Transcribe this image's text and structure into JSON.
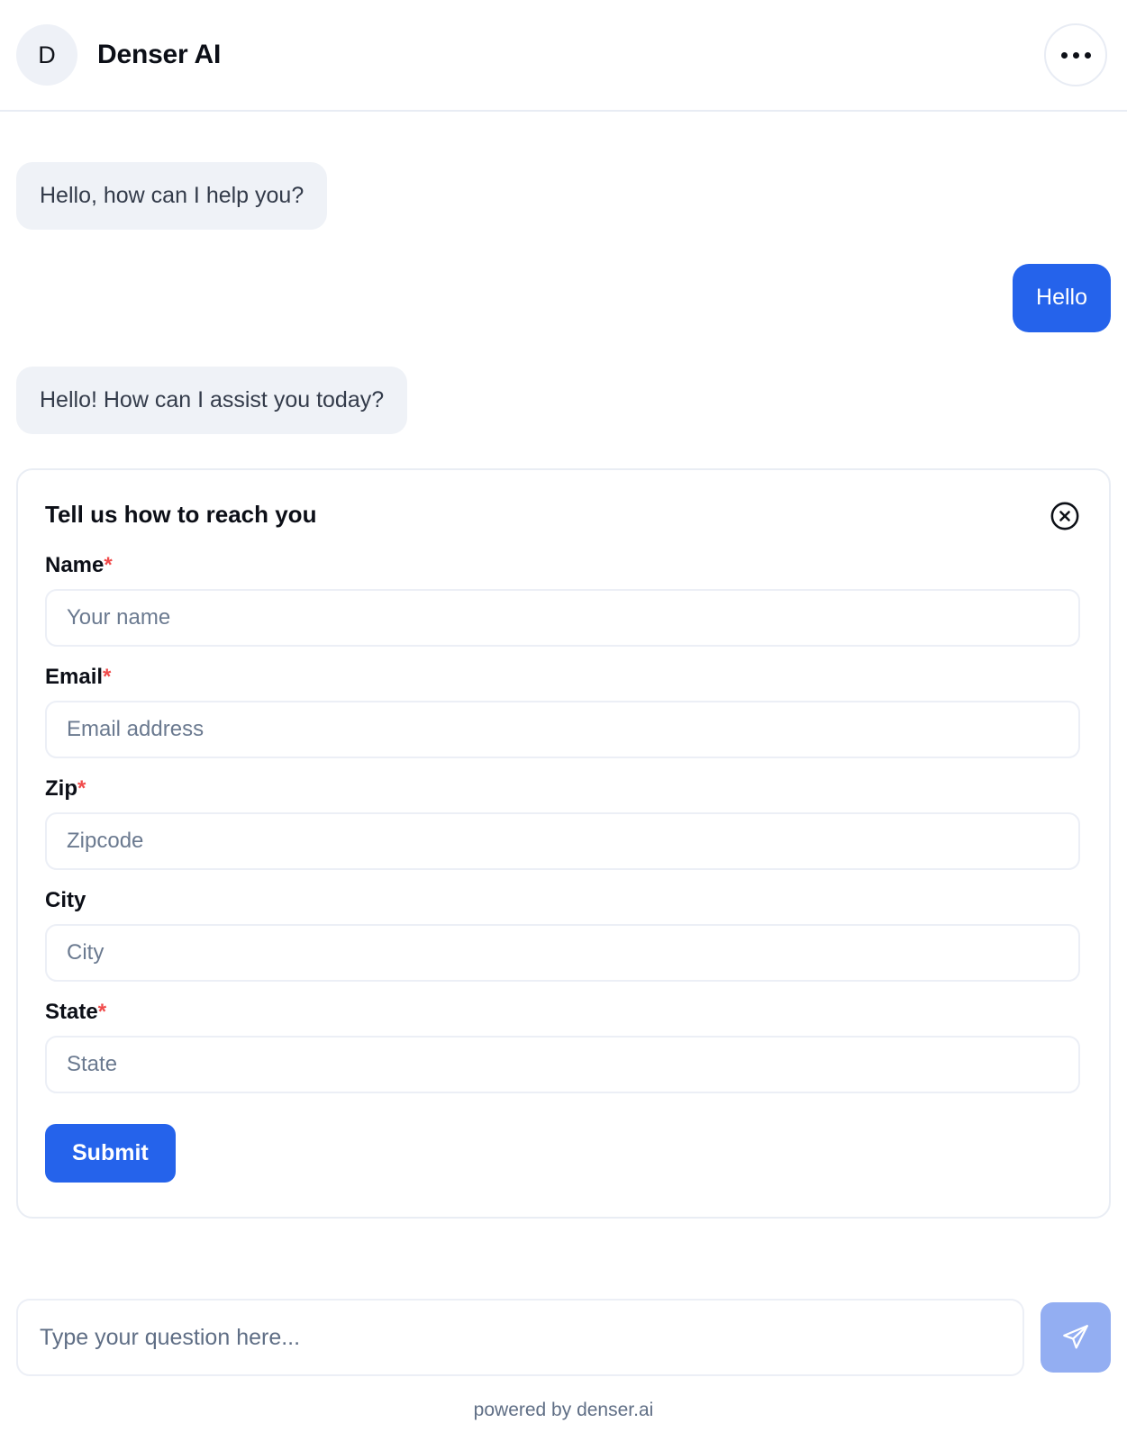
{
  "header": {
    "avatar_initial": "D",
    "title": "Denser AI",
    "menu_icon": "ellipsis-icon"
  },
  "conversation": {
    "messages": [
      {
        "role": "bot",
        "text": "Hello, how can I help you?"
      },
      {
        "role": "user",
        "text": "Hello"
      },
      {
        "role": "bot",
        "text": "Hello! How can I assist you today?"
      }
    ]
  },
  "form": {
    "title": "Tell us how to reach you",
    "close_icon": "close-circle-icon",
    "required_marker": "*",
    "fields": [
      {
        "label": "Name",
        "required": true,
        "placeholder": "Your name",
        "value": ""
      },
      {
        "label": "Email",
        "required": true,
        "placeholder": "Email address",
        "value": ""
      },
      {
        "label": "Zip",
        "required": true,
        "placeholder": "Zipcode",
        "value": ""
      },
      {
        "label": "City",
        "required": false,
        "placeholder": "City",
        "value": ""
      },
      {
        "label": "State",
        "required": true,
        "placeholder": "State",
        "value": ""
      }
    ],
    "submit_label": "Submit"
  },
  "composer": {
    "placeholder": "Type your question here...",
    "value": "",
    "send_icon": "send-paper-plane-icon"
  },
  "footer": {
    "text": "powered by denser.ai"
  },
  "colors": {
    "accent": "#2563eb",
    "bot_bubble": "#eff2f7",
    "send_button": "#93aef2",
    "required_red": "#f04b4b",
    "border": "#e9edf4"
  }
}
